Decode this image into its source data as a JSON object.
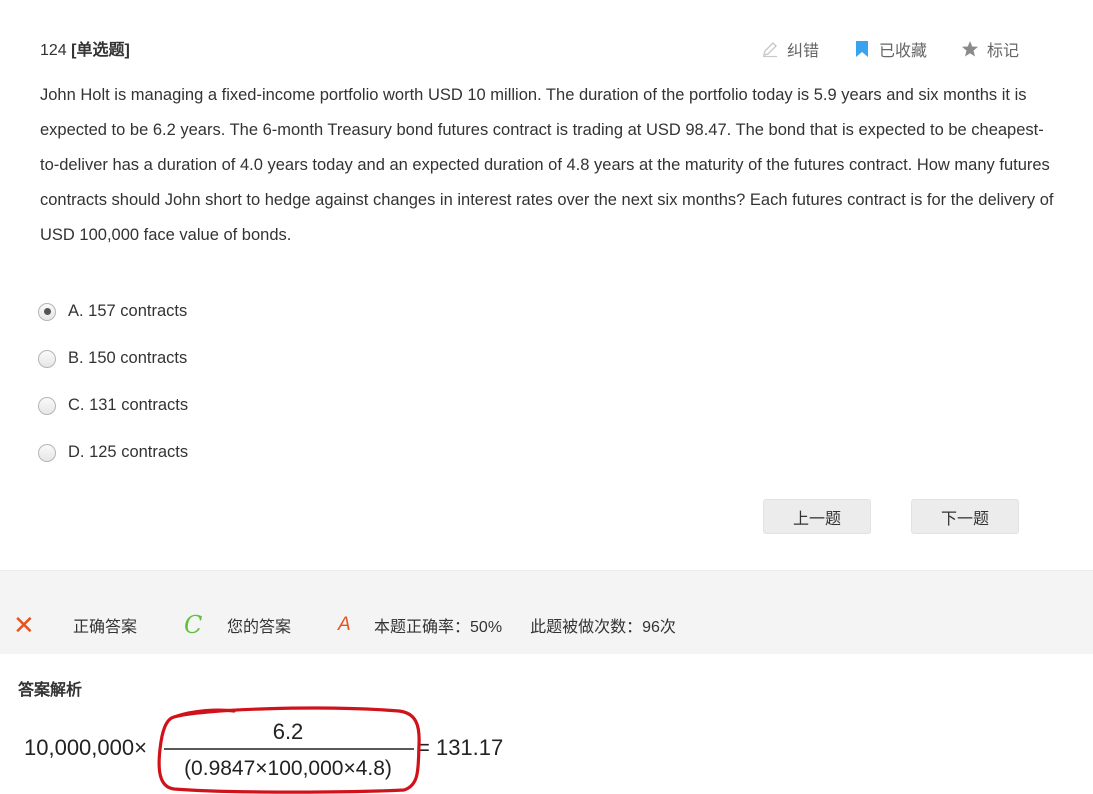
{
  "question": {
    "number": "124",
    "type": "[单选题]",
    "stem": "John Holt is managing a fixed-income portfolio worth USD 10 million. The duration of the portfolio today is 5.9 years and six months it is expected to be 6.2 years. The 6-month Treasury bond futures contract is trading at USD 98.47. The bond that is expected to be cheapest-to-deliver has a duration of 4.0 years today and an expected duration of 4.8 years at the maturity of the futures contract. How many futures contracts should John short to hedge against changes in interest rates over the next six months? Each futures contract is for the delivery of USD 100,000 face value of bonds.",
    "options": [
      {
        "label": "A. 157 contracts",
        "selected": true
      },
      {
        "label": "B. 150 contracts",
        "selected": false
      },
      {
        "label": "C. 131 contracts",
        "selected": false
      },
      {
        "label": "D. 125 contracts",
        "selected": false
      }
    ]
  },
  "actions": {
    "report": "纠错",
    "favorite": "已收藏",
    "mark": "标记"
  },
  "nav": {
    "prev": "上一题",
    "next": "下一题"
  },
  "result": {
    "wrong_mark": "✕",
    "correct_label": "正确答案",
    "correct_answer": "C",
    "your_label": "您的答案",
    "your_answer": "A",
    "accuracy": "本题正确率：50%",
    "attempts": "此题被做次数：96次"
  },
  "analysis": {
    "title": "答案解析",
    "formula": {
      "multiplier": "10,000,000×",
      "numerator": "6.2",
      "denominator": "(0.9847×100,000×4.8)",
      "result": "= 131.17"
    }
  },
  "colors": {
    "accent_orange": "#e8541e",
    "accent_green": "#5fbf3f",
    "bookmark_blue": "#3aa3f0",
    "annotation_red": "#d0121b"
  }
}
